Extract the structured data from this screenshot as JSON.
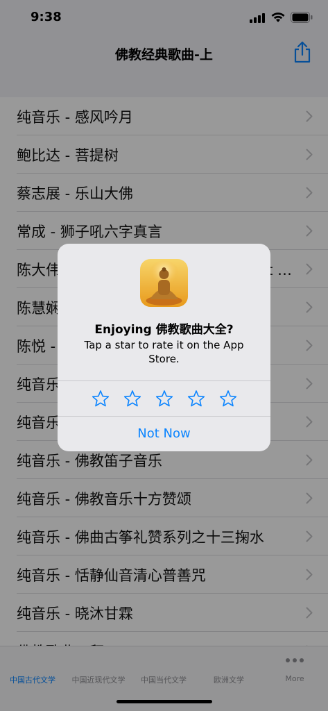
{
  "status_bar": {
    "time": "9:38"
  },
  "nav": {
    "title": "佛教经典歌曲-上",
    "share_icon": "share-icon"
  },
  "list": {
    "items": [
      "纯音乐 - 感风吟月",
      "鲍比达 - 菩提树",
      "蔡志展 - 乐山大佛",
      "常成 - 狮子吼六字真言",
      "陈大伟 - 观音心咒 (Nothing Ever Lost or t...",
      "陈慧娴 - 随心",
      "陈悦 - 心经",
      "纯音乐 - 禅境",
      "纯音乐 - 梵音",
      "纯音乐 - 佛教笛子音乐",
      "纯音乐 - 佛教音乐十方赞颂",
      "纯音乐 - 佛曲古筝礼赞系列之十三掬水",
      "纯音乐 - 恬静仙音清心普善咒",
      "纯音乐 - 晓沐甘霖",
      "佛教歌曲 - 拜"
    ]
  },
  "alert": {
    "title": "Enjoying 佛教歌曲大全?",
    "message": "Tap a star to rate it on the App Store.",
    "stars": 5,
    "dismiss_label": "Not Now",
    "accent_color": "#0a84ff"
  },
  "tabs": [
    {
      "label": "中国古代文学",
      "active": true
    },
    {
      "label": "中国近现代文学",
      "active": false
    },
    {
      "label": "中国当代文学",
      "active": false
    },
    {
      "label": "欧洲文学",
      "active": false
    },
    {
      "label": "More",
      "active": false,
      "icon": "more-dots-icon"
    }
  ]
}
